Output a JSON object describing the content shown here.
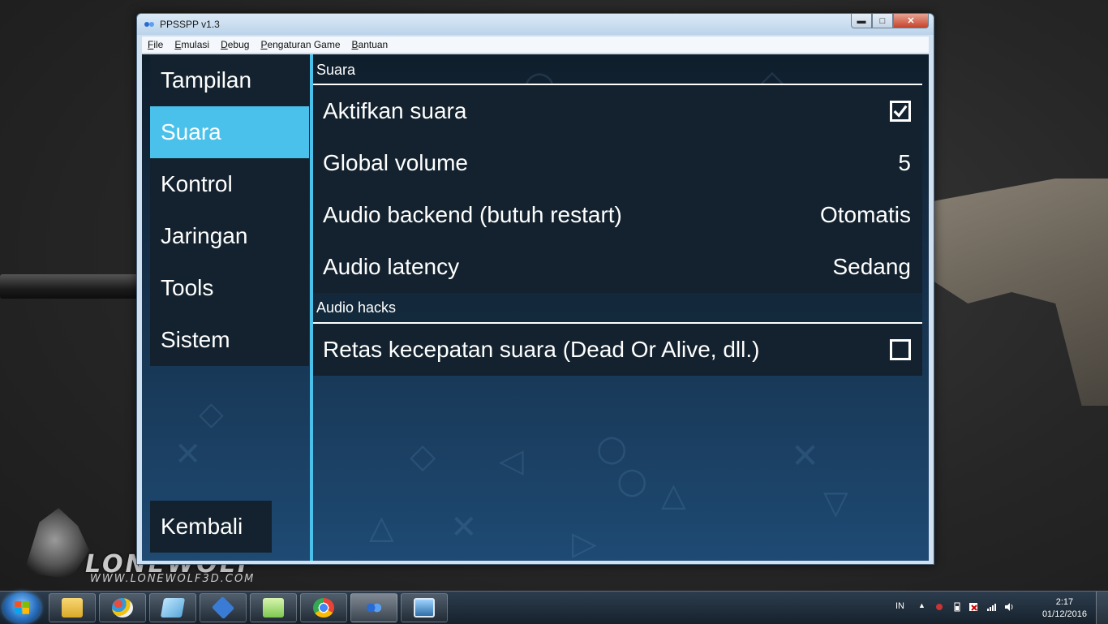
{
  "desktop": {
    "logo_brand": "LONEWOLF",
    "logo_site": "WWW.LONEWOLF3D.COM"
  },
  "window": {
    "title": "PPSSPP v1.3",
    "controls": {
      "minimize": "▬",
      "maximize": "□",
      "close": "✕"
    }
  },
  "menu": [
    "File",
    "Emulasi",
    "Debug",
    "Pengaturan Game",
    "Bantuan"
  ],
  "sidebar": {
    "items": [
      {
        "label": "Tampilan"
      },
      {
        "label": "Suara"
      },
      {
        "label": "Kontrol"
      },
      {
        "label": "Jaringan"
      },
      {
        "label": "Tools"
      },
      {
        "label": "Sistem"
      }
    ],
    "active": "Suara",
    "back_label": "Kembali"
  },
  "sections": [
    {
      "title": "Suara",
      "rows": [
        {
          "label": "Aktifkan suara",
          "checked": true
        },
        {
          "label": "Global volume",
          "value": "5"
        },
        {
          "label": "Audio backend (butuh restart)",
          "value": "Otomatis"
        },
        {
          "label": "Audio latency",
          "value": "Sedang"
        }
      ]
    },
    {
      "title": "Audio hacks",
      "rows": [
        {
          "label": "Retas kecepatan suara (Dead Or Alive, dll.)",
          "checked": false
        }
      ]
    }
  ],
  "colors": {
    "accent": "#4ac1ea",
    "row_bg": "#13222e"
  },
  "taskbar": {
    "apps": [
      "file-explorer",
      "paint",
      "notepad",
      "network-app",
      "notepad-plus-plus",
      "chrome",
      "ppsspp",
      "photo-viewer"
    ],
    "active_app": "ppsspp",
    "language": "IN",
    "time": "2:17",
    "date": "01/12/2016"
  }
}
